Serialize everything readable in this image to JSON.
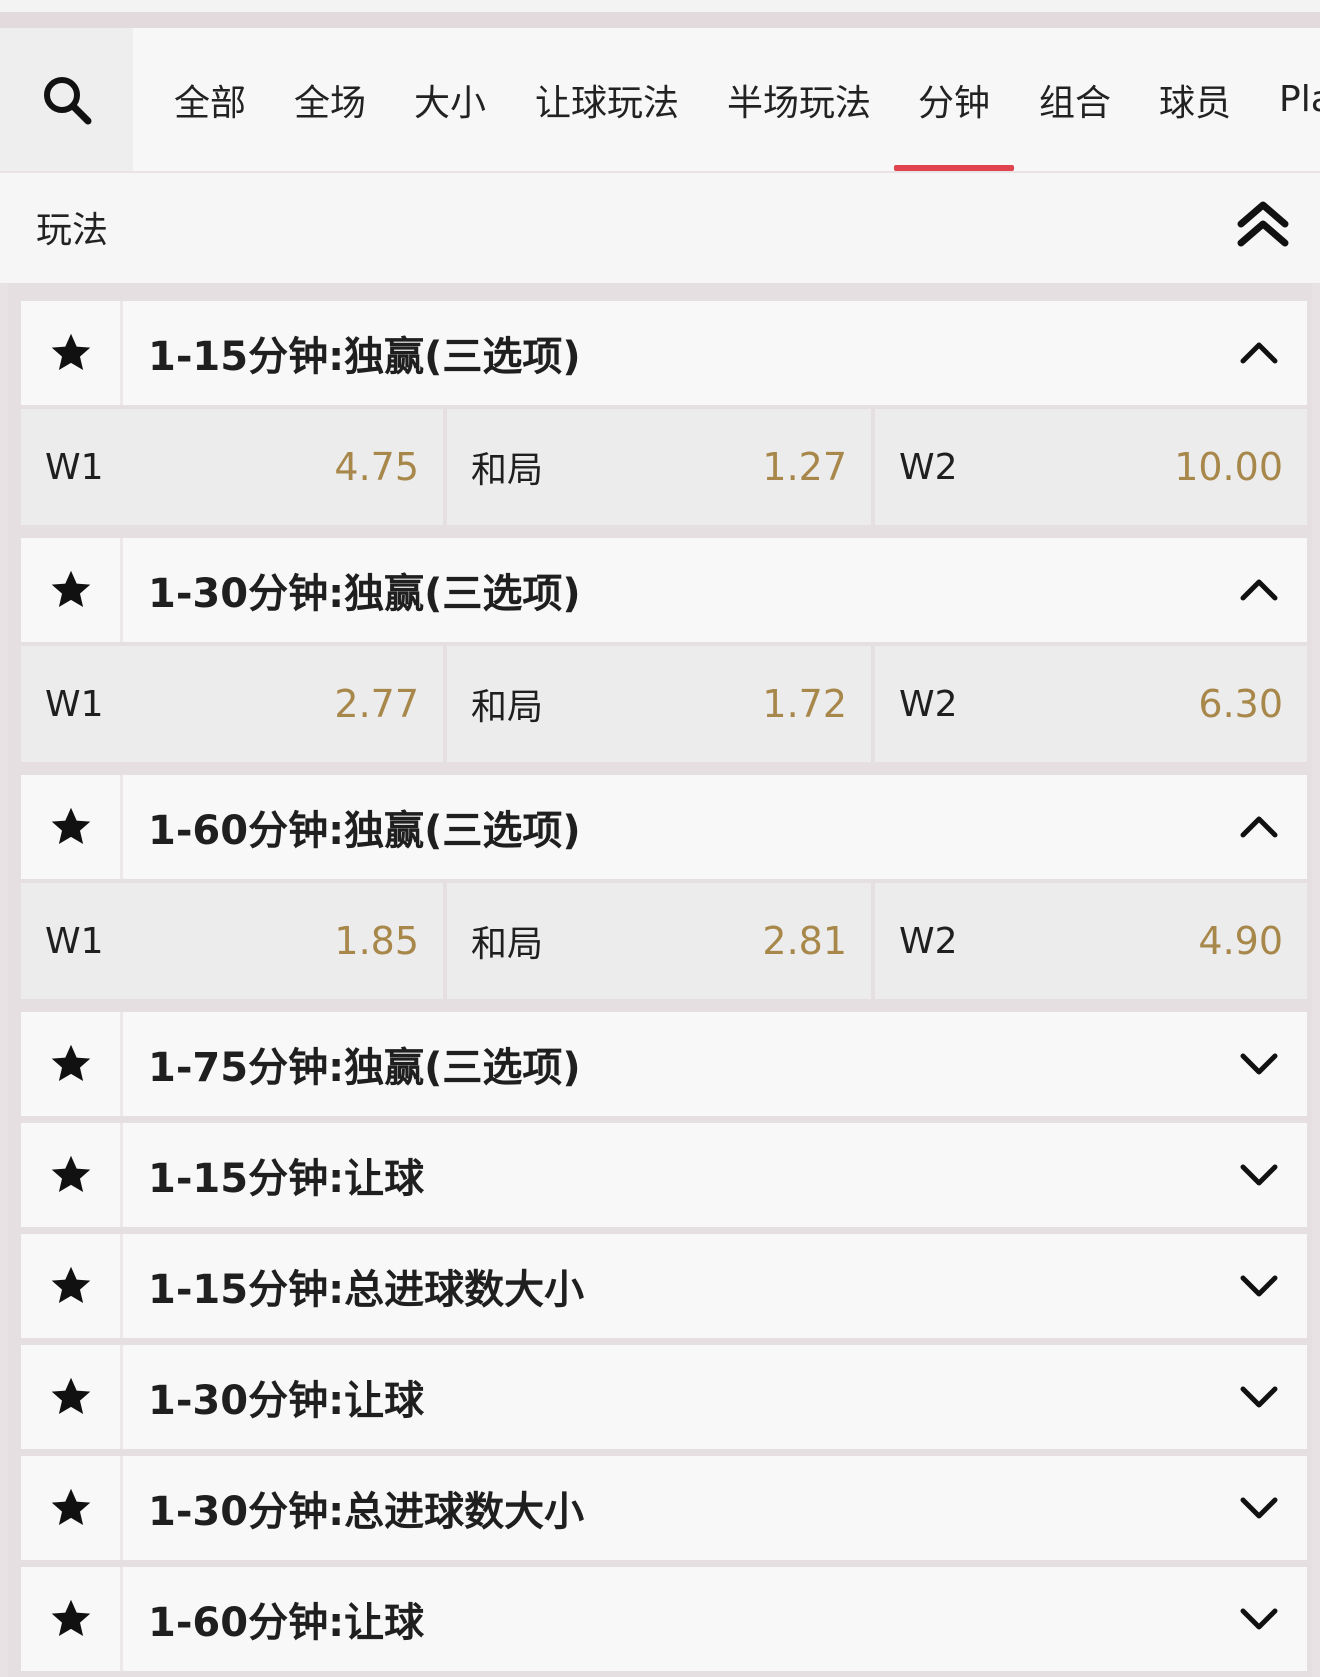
{
  "tabs": [
    {
      "label": "全部"
    },
    {
      "label": "全场"
    },
    {
      "label": "大小"
    },
    {
      "label": "让球玩法"
    },
    {
      "label": "半场玩法"
    },
    {
      "label": "分钟",
      "active": true
    },
    {
      "label": "组合"
    },
    {
      "label": "球员"
    },
    {
      "label": "Pla"
    }
  ],
  "section": {
    "title": "玩法"
  },
  "markets": [
    {
      "title": "1-15分钟:独赢(三选项)",
      "expanded": true,
      "odds": [
        {
          "label": "W1",
          "value": "4.75"
        },
        {
          "label": "和局",
          "value": "1.27"
        },
        {
          "label": "W2",
          "value": "10.00"
        }
      ]
    },
    {
      "title": "1-30分钟:独赢(三选项)",
      "expanded": true,
      "odds": [
        {
          "label": "W1",
          "value": "2.77"
        },
        {
          "label": "和局",
          "value": "1.72"
        },
        {
          "label": "W2",
          "value": "6.30"
        }
      ]
    },
    {
      "title": "1-60分钟:独赢(三选项)",
      "expanded": true,
      "odds": [
        {
          "label": "W1",
          "value": "1.85"
        },
        {
          "label": "和局",
          "value": "2.81"
        },
        {
          "label": "W2",
          "value": "4.90"
        }
      ]
    },
    {
      "title": "1-75分钟:独赢(三选项)",
      "expanded": false
    },
    {
      "title": "1-15分钟:让球",
      "expanded": false
    },
    {
      "title": "1-15分钟:总进球数大小",
      "expanded": false
    },
    {
      "title": "1-30分钟:让球",
      "expanded": false
    },
    {
      "title": "1-30分钟:总进球数大小",
      "expanded": false
    },
    {
      "title": "1-60分钟:让球",
      "expanded": false
    }
  ],
  "colors": {
    "accent": "#e0454f",
    "odds": "#a8874b"
  },
  "icons": {
    "search": "search-icon",
    "favorite": "star-icon",
    "collapse_all": "double-chevron-up-icon",
    "expanded": "chevron-up-icon",
    "collapsed": "chevron-down-icon"
  }
}
